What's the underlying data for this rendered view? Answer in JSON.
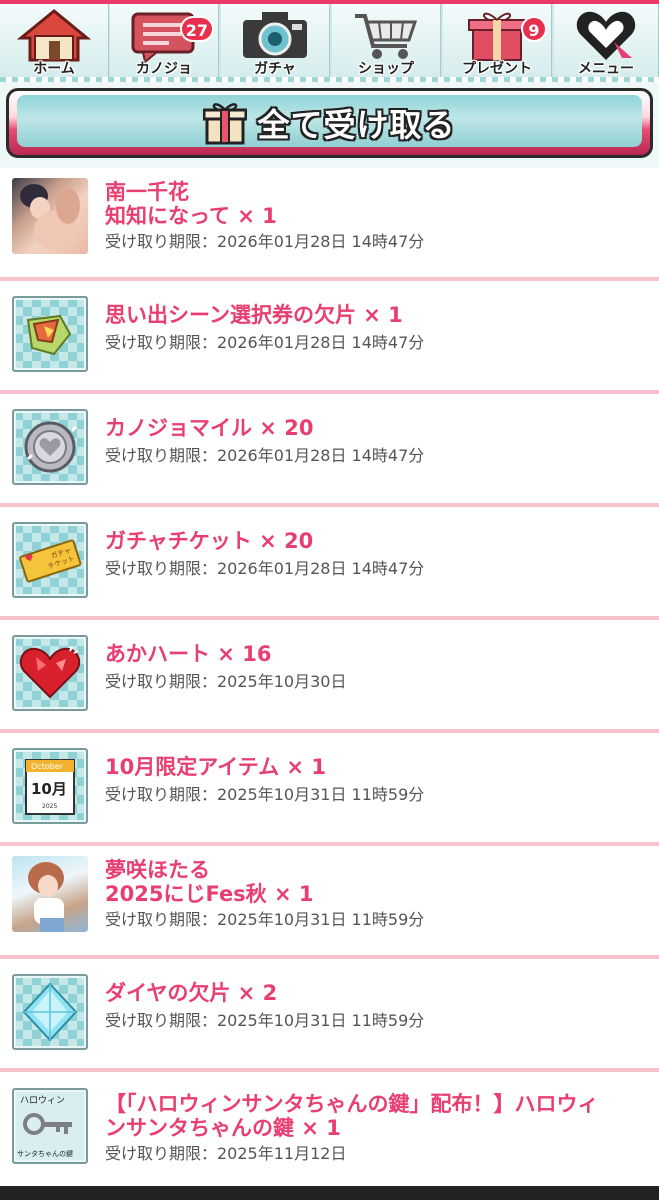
{
  "nav": {
    "items": [
      {
        "label": "ホーム",
        "icon": "house-icon"
      },
      {
        "label": "カノジョ",
        "icon": "chat-bubble-icon",
        "badge": "27"
      },
      {
        "label": "ガチャ",
        "icon": "camera-icon"
      },
      {
        "label": "ショップ",
        "icon": "cart-icon"
      },
      {
        "label": "プレゼント",
        "icon": "gift-icon",
        "badge": "9"
      },
      {
        "label": "メニュー",
        "icon": "heart-menu-icon"
      }
    ]
  },
  "receive_all": {
    "label": "全て受け取る",
    "icon": "gift-icon"
  },
  "expiry_prefix": "受け取り期限：",
  "items": [
    {
      "name": "南一千花\n知知になって × 1",
      "expiry": "受け取り期限：2026年01月28日 14時47分",
      "icon": "character-card-icon"
    },
    {
      "name": "思い出シーン選択券の欠片 × 1",
      "expiry": "受け取り期限：2026年01月28日 14時47分",
      "icon": "ticket-fragment-icon"
    },
    {
      "name": "カノジョマイル × 20",
      "expiry": "受け取り期限：2026年01月28日 14時47分",
      "icon": "coin-icon"
    },
    {
      "name": "ガチャチケット × 20",
      "expiry": "受け取り期限：2026年01月28日 14時47分",
      "icon": "gacha-ticket-icon",
      "ticket_text": "ガチャ\nチケット"
    },
    {
      "name": "あかハート × 16",
      "expiry": "受け取り期限：2025年10月30日",
      "icon": "red-heart-icon"
    },
    {
      "name": "10月限定アイテム × 1",
      "expiry": "受け取り期限：2025年10月31日 11時59分",
      "icon": "calendar-icon",
      "calendar": {
        "top": "October",
        "month": "10月",
        "year": "2025"
      }
    },
    {
      "name": "夢咲ほたる\n2025にじFes秋 × 1",
      "expiry": "受け取り期限：2025年10月31日 11時59分",
      "icon": "character-card-icon"
    },
    {
      "name": "ダイヤの欠片 × 2",
      "expiry": "受け取り期限：2025年10月31日 11時59分",
      "icon": "diamond-icon"
    },
    {
      "name": "【「ハロウィンサンタちゃんの鍵」配布！】ハロウィンサンタちゃんの鍵 × 1",
      "expiry": "受け取り期限：2025年11月12日",
      "icon": "key-icon",
      "key_text_top": "ハロウィン",
      "key_text_bottom": "サンタちゃんの鍵"
    }
  ],
  "colors": {
    "accent": "#e83e72",
    "tile": "#8fd1d4",
    "nav_bg": "#d4ecec"
  }
}
